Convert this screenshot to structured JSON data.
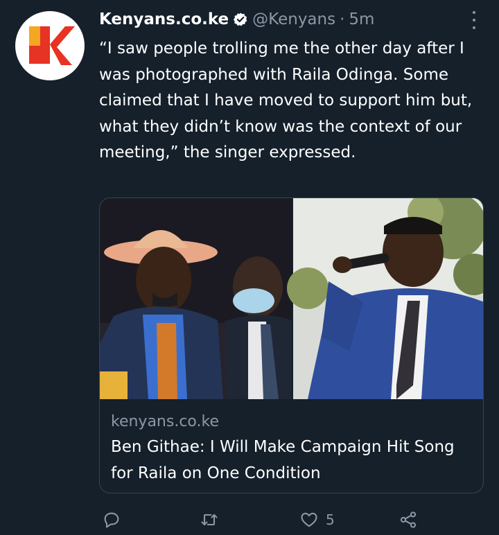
{
  "tweet": {
    "author_name": "Kenyans.co.ke",
    "handle": "@Kenyans",
    "separator": "·",
    "time": "5m",
    "text": "“I saw people trolling me the other day after I was photographed with Raila Odinga. Some claimed that I have moved to support him but, what they didn’t know was the context of our meeting,” the singer expressed."
  },
  "card": {
    "domain": "kenyans.co.ke",
    "title": "Ben Githae: I Will Make Campaign Hit Song for Raila on One Condition"
  },
  "actions": {
    "reply_icon": "reply-icon",
    "retweet_icon": "retweet-icon",
    "like_icon": "heart-icon",
    "like_count": "5",
    "share_icon": "share-icon"
  },
  "colors": {
    "background": "#15202b",
    "secondary_text": "#8b98a5",
    "verified_badge": "#ffffff",
    "border": "#38444d",
    "brand_red": "#e63323",
    "brand_orange": "#f5a623"
  }
}
